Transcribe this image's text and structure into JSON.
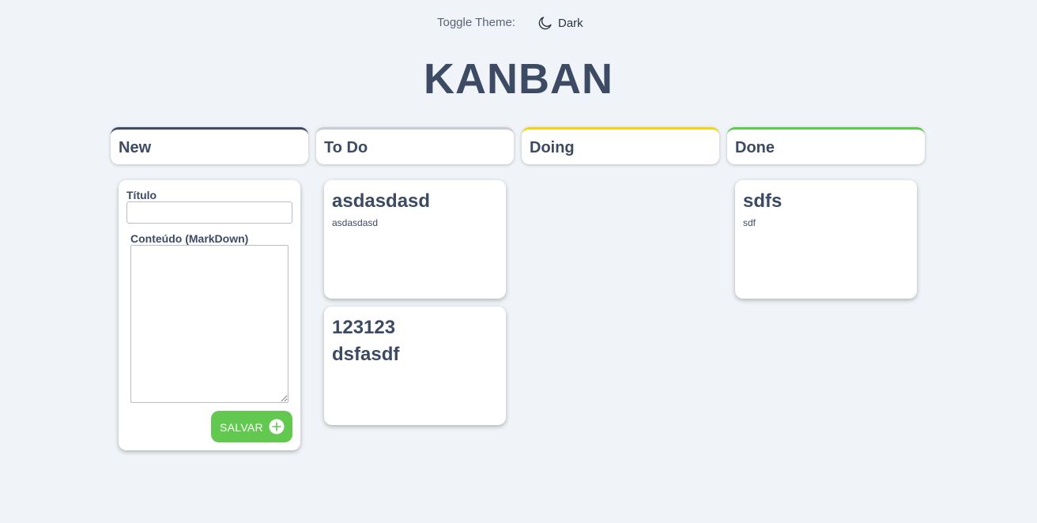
{
  "theme": {
    "label": "Toggle Theme:",
    "toggle_label": "Dark",
    "toggle_icon": "moon-icon"
  },
  "title": "KANBAN",
  "columns": [
    {
      "name": "New",
      "accent": "#3d4a63"
    },
    {
      "name": "To Do",
      "accent": "#c9cdd3"
    },
    {
      "name": "Doing",
      "accent": "#f2d40f"
    },
    {
      "name": "Done",
      "accent": "#62c84f"
    }
  ],
  "form": {
    "title_label": "Título",
    "title_value": "",
    "content_label": "Conteúdo (MarkDown)",
    "content_value": "",
    "save_label": "SALVAR",
    "save_icon": "plus-circle-icon",
    "save_color": "#62c84f"
  },
  "todo_cards": [
    {
      "title": "asdasdasd",
      "content": "asdasdasd"
    },
    {
      "title": "123123",
      "content": "dsfasdf"
    }
  ],
  "done_cards": [
    {
      "title": "sdfs",
      "content": "sdf"
    }
  ]
}
